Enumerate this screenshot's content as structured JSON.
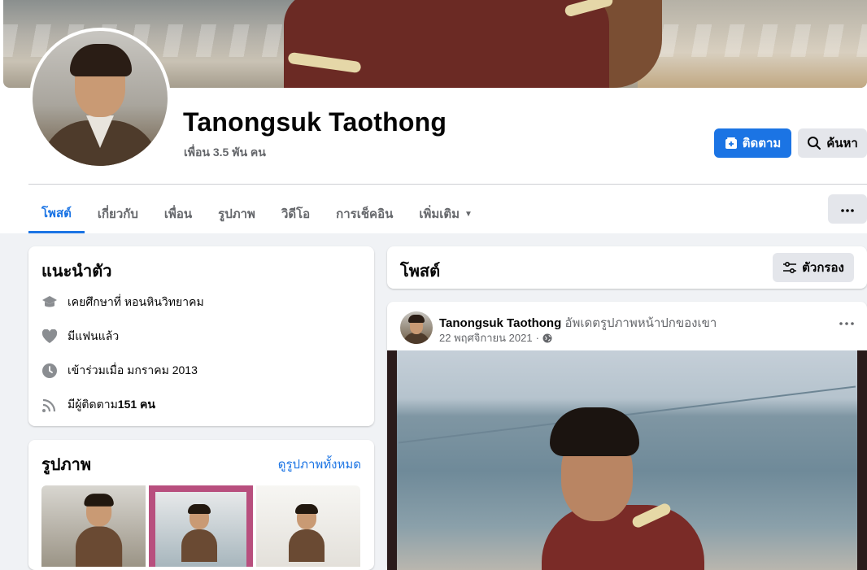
{
  "profile": {
    "name": "Tanongsuk Taothong",
    "friends": "เพื่อน 3.5 พัน คน",
    "follow_label": "ติดตาม",
    "search_label": "ค้นหา"
  },
  "tabs": [
    {
      "label": "โพสต์",
      "active": true
    },
    {
      "label": "เกี่ยวกับ"
    },
    {
      "label": "เพื่อน"
    },
    {
      "label": "รูปภาพ"
    },
    {
      "label": "วิดีโอ"
    },
    {
      "label": "การเช็คอิน"
    },
    {
      "label": "เพิ่มเติม"
    }
  ],
  "intro": {
    "title": "แนะนำตัว",
    "items": [
      {
        "icon": "graduation-cap-icon",
        "text": "เคยศึกษาที่ หอนหินวิทยาคม"
      },
      {
        "icon": "heart-icon",
        "text": "มีแฟนแล้ว"
      },
      {
        "icon": "clock-icon",
        "text": "เข้าร่วมเมื่อ มกราคม 2013"
      },
      {
        "icon": "rss-icon",
        "text_prefix": "มีผู้ติดตาม ",
        "text_bold": "151 คน"
      }
    ]
  },
  "photos": {
    "title": "รูปภาพ",
    "see_all": "ดูรูปภาพทั้งหมด"
  },
  "posts": {
    "title": "โพสต์",
    "filter_label": "ตัวกรอง"
  },
  "post": {
    "author": "Tanongsuk Taothong",
    "action": "อัพเดตรูปภาพหน้าปกของเขา",
    "date": "22 พฤศจิกายน 2021",
    "separator": "·",
    "privacy_icon": "globe-icon"
  },
  "colors": {
    "accent": "#1b74e4",
    "background": "#f0f2f5",
    "secondary_text": "#65676b",
    "button_gray": "#e4e6eb"
  }
}
